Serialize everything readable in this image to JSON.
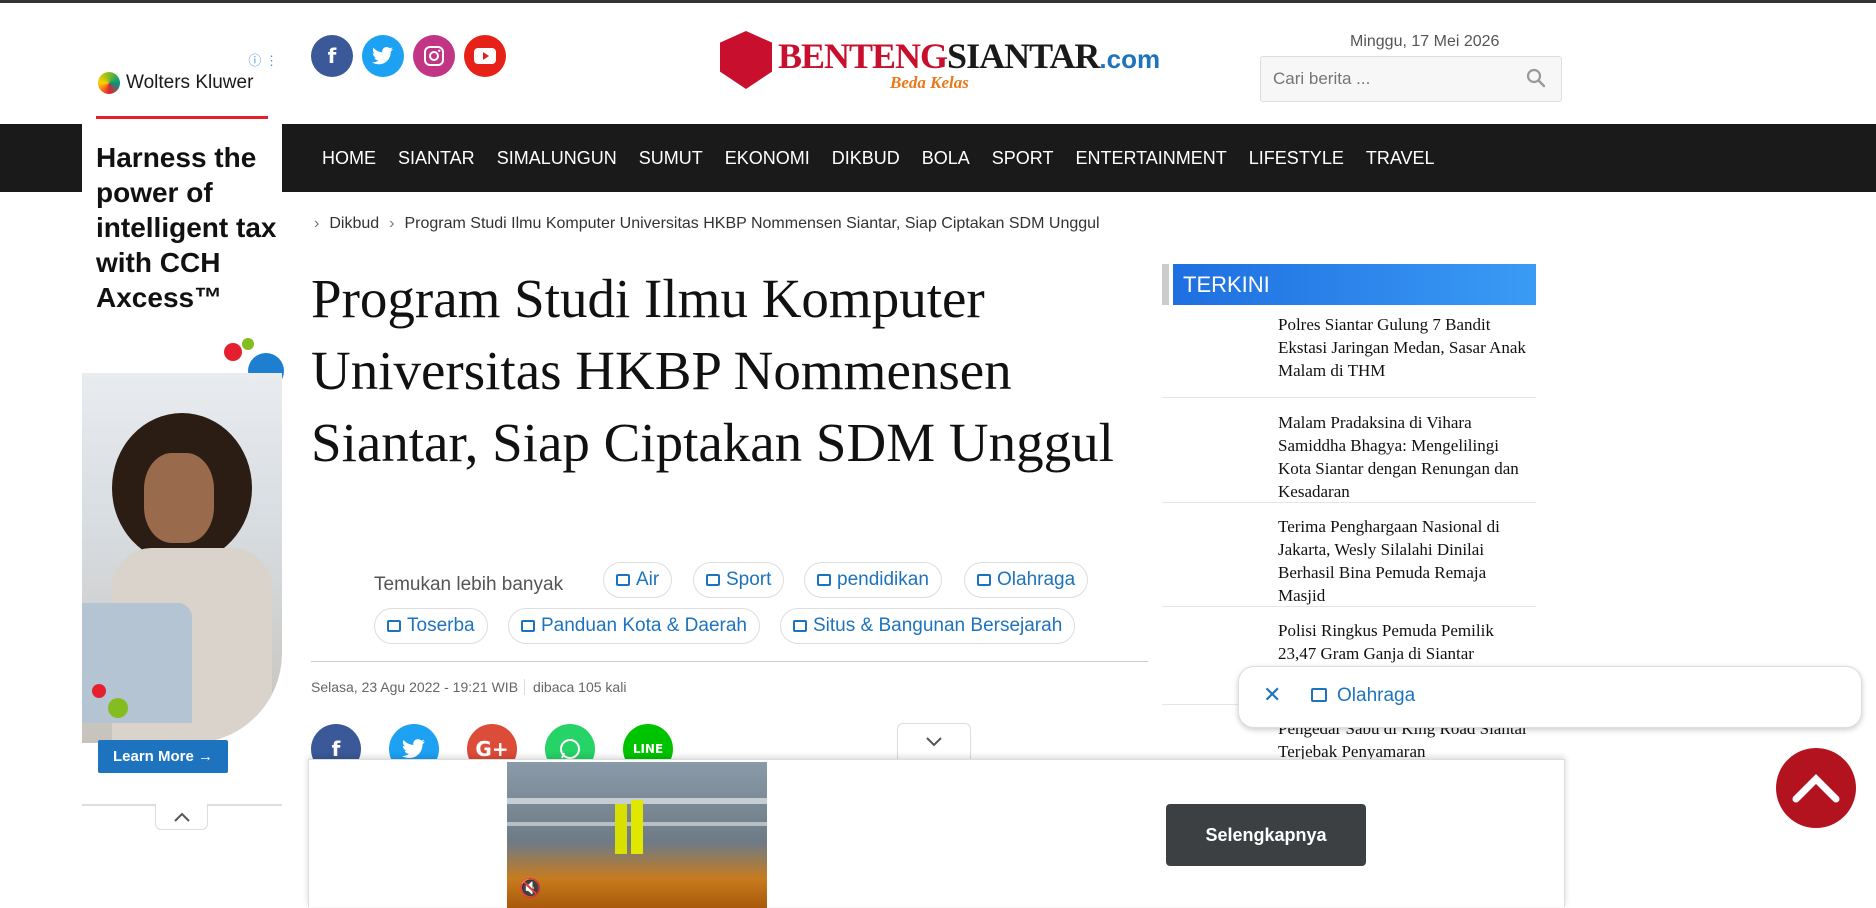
{
  "header": {
    "social": [
      {
        "name": "facebook-icon",
        "glyph": "f"
      },
      {
        "name": "twitter-icon",
        "glyph": "t"
      },
      {
        "name": "instagram-icon",
        "glyph": "◎"
      },
      {
        "name": "youtube-icon",
        "glyph": "▶"
      }
    ],
    "logo": {
      "part1": "BENTENG",
      "part2": "SIANTAR",
      "part3": ".com",
      "tagline": "Beda Kelas"
    },
    "date": "Minggu, 17 Mei 2026",
    "search_placeholder": "Cari berita ..."
  },
  "nav": {
    "items": [
      "HOME",
      "SIANTAR",
      "SIMALUNGUN",
      "SUMUT",
      "EKONOMI",
      "DIKBUD",
      "BOLA",
      "SPORT",
      "ENTERTAINMENT",
      "LIFESTYLE",
      "TRAVEL"
    ]
  },
  "ad_left": {
    "brand": "Wolters Kluwer",
    "headline": "Harness the power of intelligent tax with CCH Axcess™",
    "cta": "Learn More →"
  },
  "breadcrumb": {
    "category": "Dikbud",
    "current": "Program Studi Ilmu Komputer Universitas HKBP Nommensen Siantar, Siap Ciptakan SDM Unggul"
  },
  "article": {
    "title": "Program Studi Ilmu Komputer Universitas HKBP Nommensen Siantar, Siap Ciptakan SDM Unggul",
    "discover_label": "Temukan lebih banyak",
    "chips": [
      "Air",
      "Sport",
      "pendidikan",
      "Olahraga",
      "Toserba",
      "Panduan Kota & Daerah",
      "Situs & Bangunan Bersejarah"
    ],
    "date": "Selasa, 23 Agu 2022 - 19:21 WIB",
    "views": "dibaca 105 kali"
  },
  "sidebar": {
    "heading": "TERKINI",
    "news": [
      "Polres Siantar Gulung 7 Bandit Ekstasi Jaringan Medan, Sasar Anak Malam di THM",
      "Malam Pradaksina di Vihara Samiddha Bhagya: Mengelilingi Kota Siantar dengan Renungan dan Kesadaran",
      "Terima Penghargaan Nasional di Jakarta, Wesly Silalahi Dinilai Berhasil Bina Pemuda Remaja Masjid",
      "Polisi Ringkus Pemuda Pemilik 23,47 Gram Ganja di Siantar",
      "Pengedar Sabu di King Road Siantar Terjebak Penyamaran"
    ]
  },
  "floating_chip": {
    "label": "Olahraga"
  },
  "video_ad": {
    "cta": "Selengkapnya"
  },
  "colors": {
    "nav_bg": "#1a1a1a",
    "accent_blue": "#1e73be",
    "brand_red": "#c8102e",
    "totop_red": "#b3121f"
  }
}
